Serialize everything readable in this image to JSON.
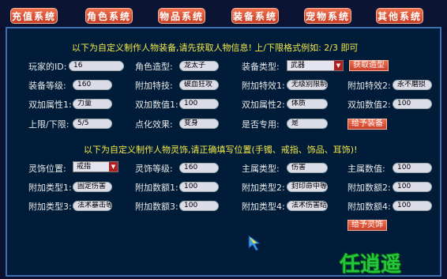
{
  "topnav": {
    "recharge": "充值系统",
    "character": "角色系统",
    "items": "物品系统",
    "equipment": "装备系统",
    "pets": "宠物系统",
    "other": "其他系统"
  },
  "equip": {
    "notice": "以下为自定义制作人物装备,请先获取人物信息! 上/下限格式例如: 2/3 即可",
    "player_id_label": "玩家的ID:",
    "player_id_value": "16",
    "char_model_label": "角色造型:",
    "char_model_value": "龙太子",
    "equip_type_label": "装备类型:",
    "equip_type_value": "武器",
    "get_model_button": "获取造型",
    "equip_level_label": "装备等级:",
    "equip_level_value": "160",
    "extra_skill_label": "附加特技:",
    "extra_skill_value": "破血狂攻",
    "extra_effect1_label": "附加特效1:",
    "extra_effect1_value": "无级别限制",
    "extra_effect2_label": "附加特效2:",
    "extra_effect2_value": "永不磨损",
    "dual_attr1_label": "双加属性1:",
    "dual_attr1_value": "力量",
    "dual_val1_label": "双加数值1:",
    "dual_val1_value": "100",
    "dual_attr2_label": "双加属性2:",
    "dual_attr2_value": "体质",
    "dual_val2_label": "双加数值2:",
    "dual_val2_value": "100",
    "limit_label": "上限/下限:",
    "limit_value": "5/5",
    "spot_effect_label": "点化效果:",
    "spot_effect_value": "变身",
    "exclusive_label": "是否专用:",
    "exclusive_value": "是",
    "give_button": "给予装备"
  },
  "ling": {
    "notice": "以下为自定义制作人物灵饰,请正确填写位置(手镯、戒指、饰品、耳饰)!",
    "slot_label": "灵饰位置:",
    "slot_value": "戒指",
    "level_label": "灵饰等级:",
    "level_value": "160",
    "main_type_label": "主属类型:",
    "main_type_value": "伤害",
    "main_val_label": "主属数值:",
    "main_val_value": "100",
    "add_type1_label": "附加类型1:",
    "add_type1_value": "固定伤害",
    "add_amt1_label": "附加数额1:",
    "add_amt1_value": "100",
    "add_type2_label": "附加类型2:",
    "add_type2_value": "封印命中等级",
    "add_amt2_label": "附加数额2:",
    "add_amt2_value": "100",
    "add_type3_label": "附加类型3:",
    "add_type3_value": "法术暴击等级",
    "add_amt3_label": "附加数额3:",
    "add_amt3_value": "100",
    "add_type4_label": "附加类型4:",
    "add_type4_value": "法术伤害结果",
    "add_amt4_label": "附加数额4:",
    "add_amt4_value": "100",
    "give_button": "给予灵饰"
  },
  "logo": "任逍遥",
  "colors": {
    "accent": "#e0553a",
    "notice": "#f4e84a",
    "background": "#001c38",
    "logo": "#22c83a"
  }
}
